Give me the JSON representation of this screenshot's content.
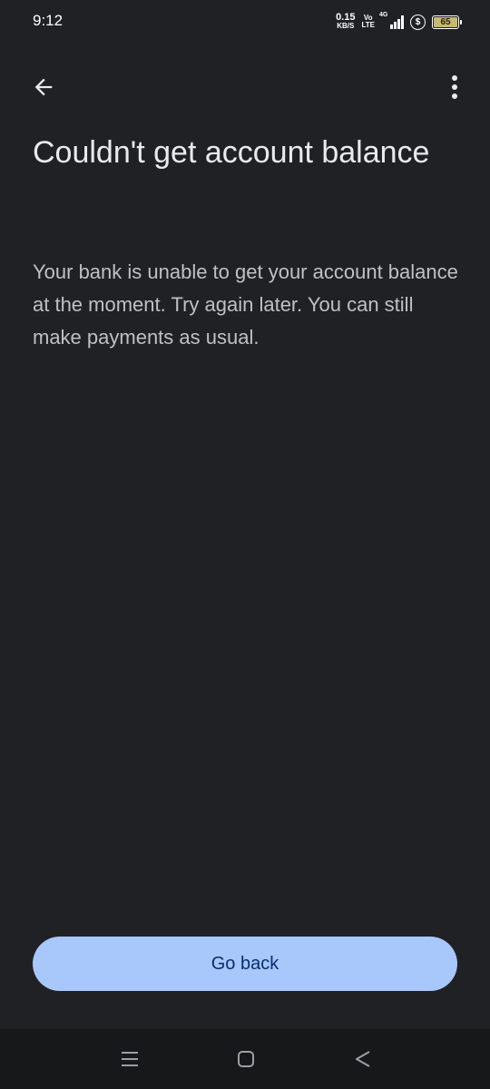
{
  "status_bar": {
    "time": "9:12",
    "net_speed_value": "0.15",
    "net_speed_unit": "KB/S",
    "volte_top": "Vo",
    "volte_bottom": "LTE",
    "network_type": "4G",
    "battery_level": "65",
    "icons": [
      "volte-icon",
      "signal-icon",
      "dollar-icon",
      "battery-icon"
    ]
  },
  "toolbar": {
    "back_icon": "arrow-back-icon",
    "more_icon": "more-vert-icon"
  },
  "content": {
    "title": "Couldn't get account balance",
    "message": "Your bank is unable to get your account balance at the moment. Try again later. You can still make payments as usual."
  },
  "actions": {
    "primary_label": "Go back"
  },
  "nav_bar": {
    "icons": [
      "recents-icon",
      "home-icon",
      "back-triangle-icon"
    ]
  },
  "colors": {
    "background": "#202124",
    "primary_button": "#a8c7fa",
    "primary_button_text": "#062e6f",
    "title_text": "#e8eaed",
    "body_text": "#bdc1c6"
  }
}
